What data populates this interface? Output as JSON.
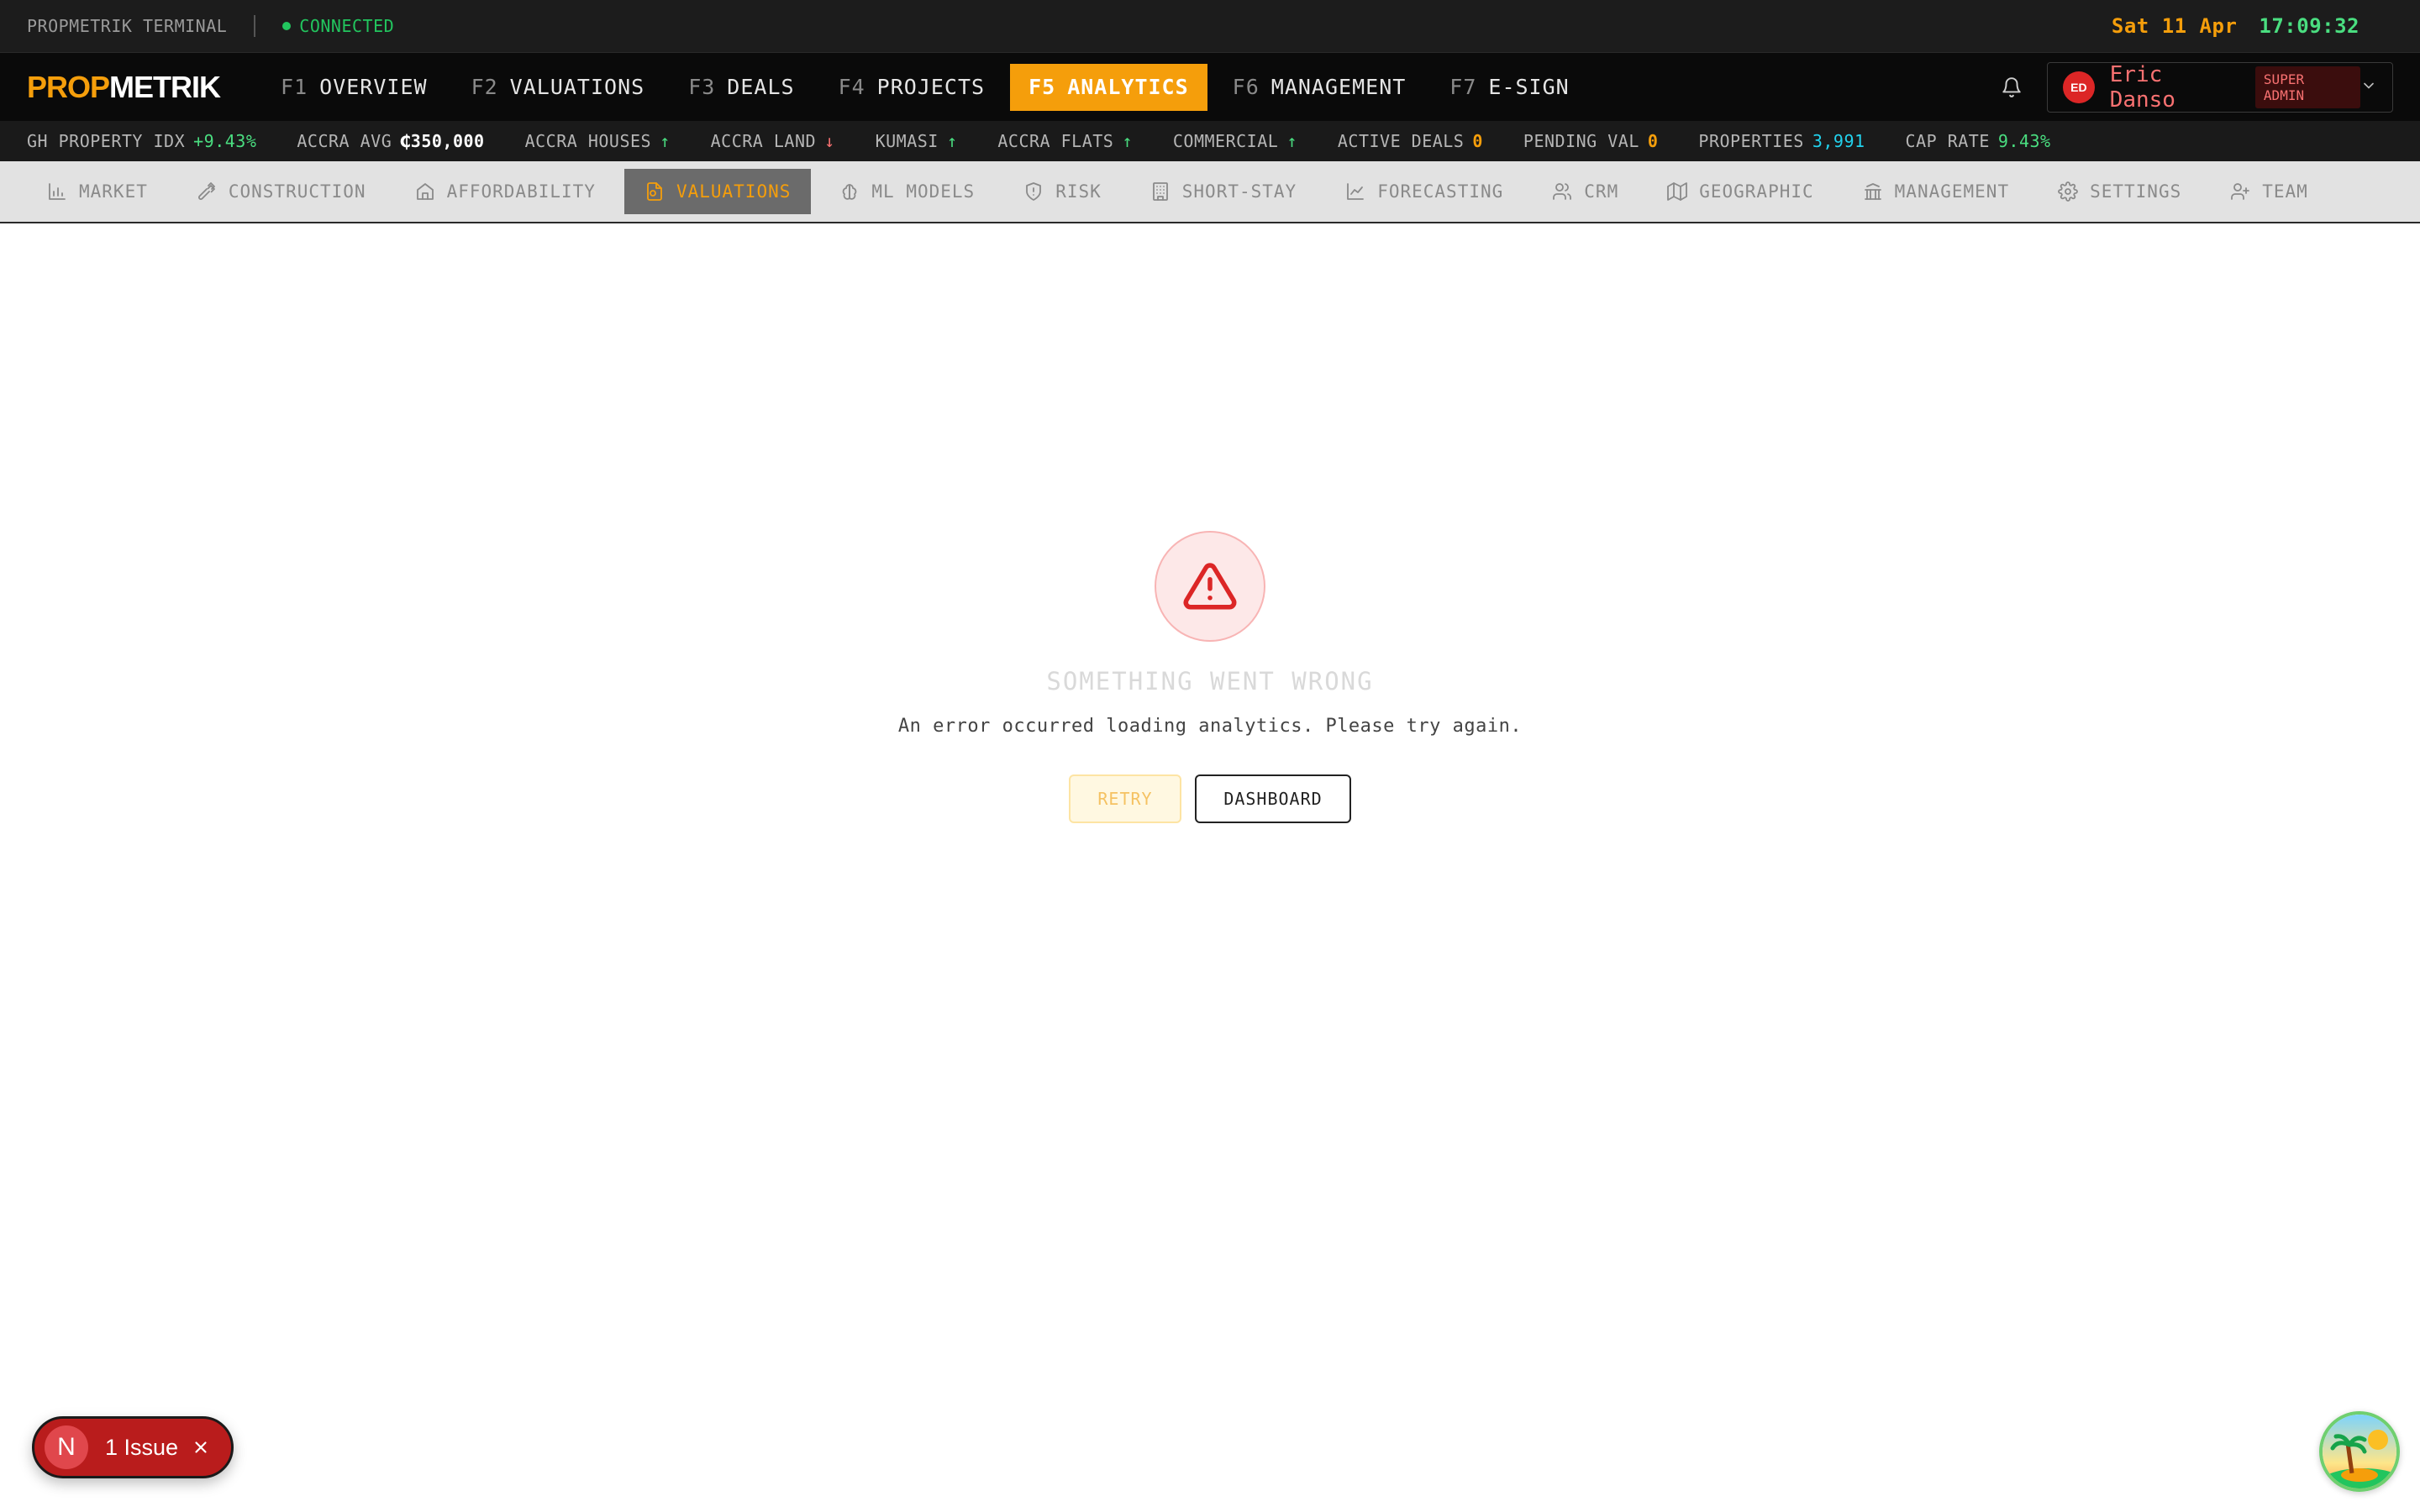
{
  "status_bar": {
    "terminal_label": "PROPMETRIK TERMINAL",
    "connection": "CONNECTED",
    "date": "Sat 11 Apr",
    "time": "17:09:32"
  },
  "logo": {
    "part1": "PROP",
    "part2": "METRIK"
  },
  "main_nav": [
    {
      "key": "F1",
      "label": "OVERVIEW",
      "active": false
    },
    {
      "key": "F2",
      "label": "VALUATIONS",
      "active": false
    },
    {
      "key": "F3",
      "label": "DEALS",
      "active": false
    },
    {
      "key": "F4",
      "label": "PROJECTS",
      "active": false
    },
    {
      "key": "F5",
      "label": "ANALYTICS",
      "active": true
    },
    {
      "key": "F6",
      "label": "MANAGEMENT",
      "active": false
    },
    {
      "key": "F7",
      "label": "E-SIGN",
      "active": false
    }
  ],
  "user": {
    "initials": "ED",
    "name": "Eric Danso",
    "role": "SUPER ADMIN"
  },
  "ticker": [
    {
      "label": "GH PROPERTY IDX",
      "value": "+9.43%",
      "color": "#4ade80"
    },
    {
      "label": "ACCRA AVG",
      "value": "₵350,000",
      "color": "#ffffff"
    },
    {
      "label": "ACCRA HOUSES",
      "value": "↑",
      "color": "#4ade80"
    },
    {
      "label": "ACCRA LAND",
      "value": "↓",
      "color": "#f87171"
    },
    {
      "label": "KUMASI",
      "value": "↑",
      "color": "#4ade80"
    },
    {
      "label": "ACCRA FLATS",
      "value": "↑",
      "color": "#4ade80"
    },
    {
      "label": "COMMERCIAL",
      "value": "↑",
      "color": "#4ade80"
    },
    {
      "label": "ACTIVE DEALS",
      "value": "0",
      "color": "#f59e0b"
    },
    {
      "label": "PENDING VAL",
      "value": "0",
      "color": "#f59e0b"
    },
    {
      "label": "PROPERTIES",
      "value": "3,991",
      "color": "#22d3ee"
    },
    {
      "label": "CAP RATE",
      "value": "9.43%",
      "color": "#4ade80"
    }
  ],
  "sub_nav": [
    {
      "icon": "bar-chart-icon",
      "label": "MARKET",
      "active": false
    },
    {
      "icon": "hammer-icon",
      "label": "CONSTRUCTION",
      "active": false
    },
    {
      "icon": "home-icon",
      "label": "AFFORDABILITY",
      "active": false
    },
    {
      "icon": "document-icon",
      "label": "VALUATIONS",
      "active": true
    },
    {
      "icon": "brain-icon",
      "label": "ML MODELS",
      "active": false
    },
    {
      "icon": "shield-icon",
      "label": "RISK",
      "active": false
    },
    {
      "icon": "building-icon",
      "label": "SHORT-STAY",
      "active": false
    },
    {
      "icon": "line-chart-icon",
      "label": "FORECASTING",
      "active": false
    },
    {
      "icon": "users-icon",
      "label": "CRM",
      "active": false
    },
    {
      "icon": "map-icon",
      "label": "GEOGRAPHIC",
      "active": false
    },
    {
      "icon": "bank-icon",
      "label": "MANAGEMENT",
      "active": false
    },
    {
      "icon": "gear-icon",
      "label": "SETTINGS",
      "active": false
    },
    {
      "icon": "team-icon",
      "label": "TEAM",
      "active": false
    }
  ],
  "error": {
    "title": "SOMETHING WENT WRONG",
    "message": "An error occurred loading analytics. Please try again.",
    "retry_label": "RETRY",
    "dashboard_label": "DASHBOARD"
  },
  "issues": {
    "badge": "N",
    "label": "1 Issue"
  },
  "colors": {
    "accent": "#f59e0b",
    "error": "#dc2626",
    "success": "#22c55e"
  }
}
